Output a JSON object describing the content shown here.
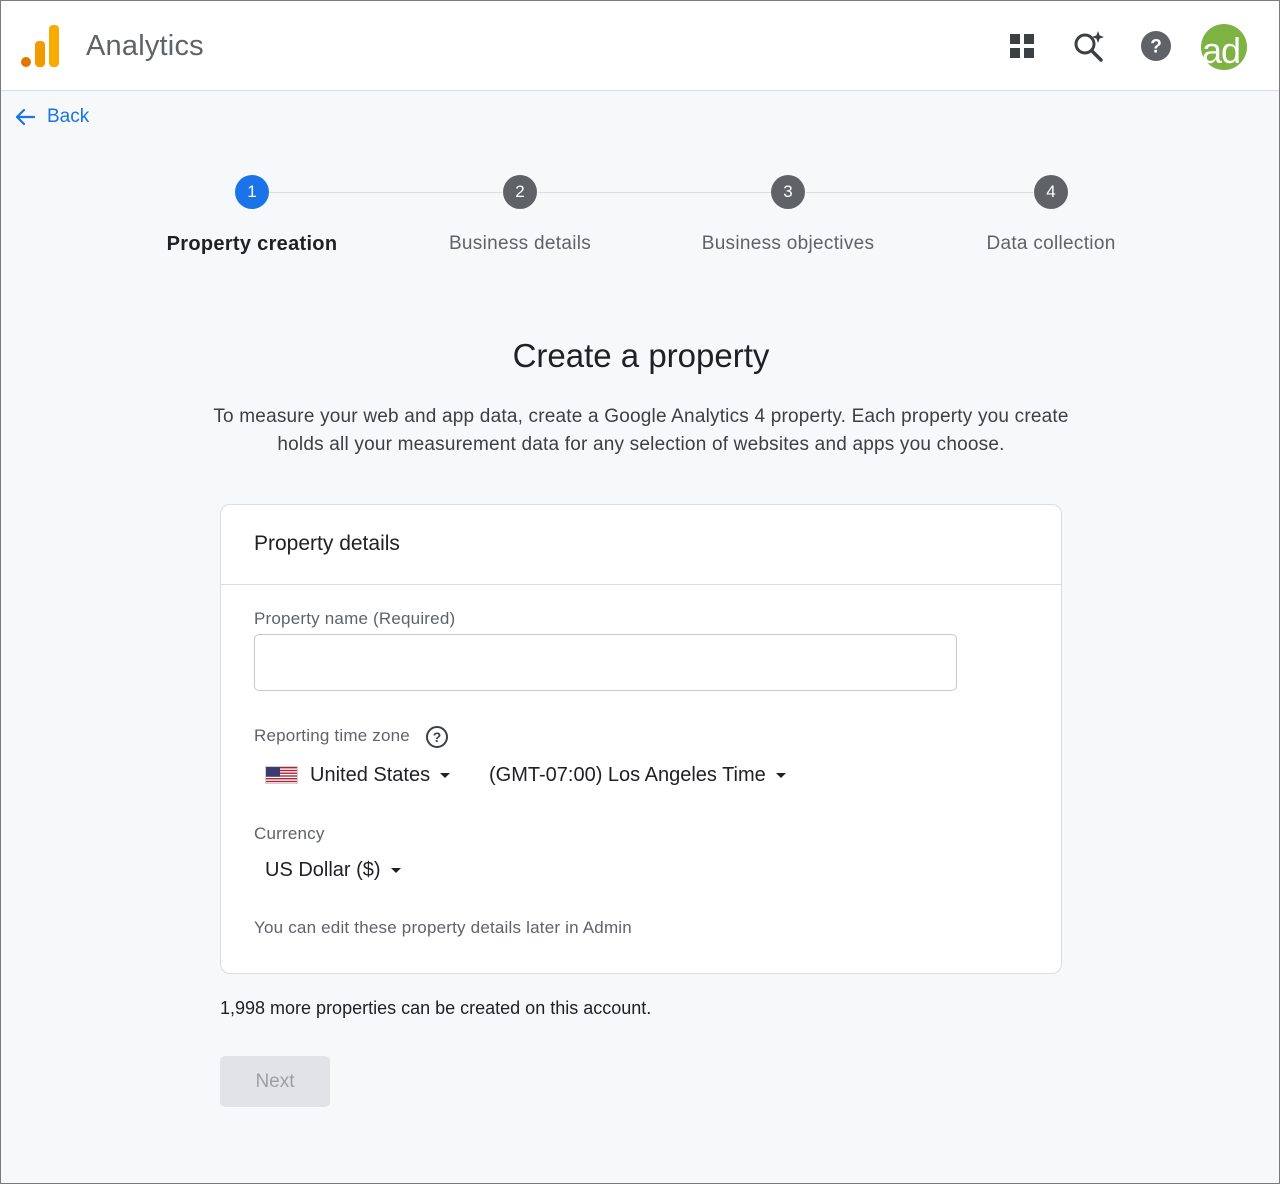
{
  "header": {
    "app_title": "Analytics",
    "icons": [
      "apps-icon",
      "search-insights-icon",
      "help-icon"
    ],
    "avatar_text": "ad"
  },
  "nav": {
    "back_label": "Back"
  },
  "stepper": {
    "steps": [
      {
        "number": "1",
        "label": "Property creation",
        "active": true
      },
      {
        "number": "2",
        "label": "Business details",
        "active": false
      },
      {
        "number": "3",
        "label": "Business objectives",
        "active": false
      },
      {
        "number": "4",
        "label": "Data collection",
        "active": false
      }
    ]
  },
  "main": {
    "title": "Create a property",
    "intro_line1": "To measure your web and app data, create a Google Analytics 4 property. Each property you create",
    "intro_line2": "holds all your measurement data for any selection of websites and apps you choose."
  },
  "card": {
    "title": "Property details",
    "property_name_label": "Property name (Required)",
    "property_name_value": "",
    "timezone_label": "Reporting time zone",
    "country_value": "United States",
    "timezone_value": "(GMT-07:00) Los Angeles Time",
    "currency_label": "Currency",
    "currency_value": "US Dollar ($)",
    "hint": "You can edit these property details later in Admin"
  },
  "footer": {
    "quota_text": "1,998 more properties can be created on this account.",
    "next_label": "Next"
  },
  "colors": {
    "accent": "#1a73e8",
    "step_inactive": "#5f6368",
    "avatar_bg": "#7cb342",
    "logo_orange": "#f9ab00",
    "logo_dark_orange": "#e37400"
  }
}
